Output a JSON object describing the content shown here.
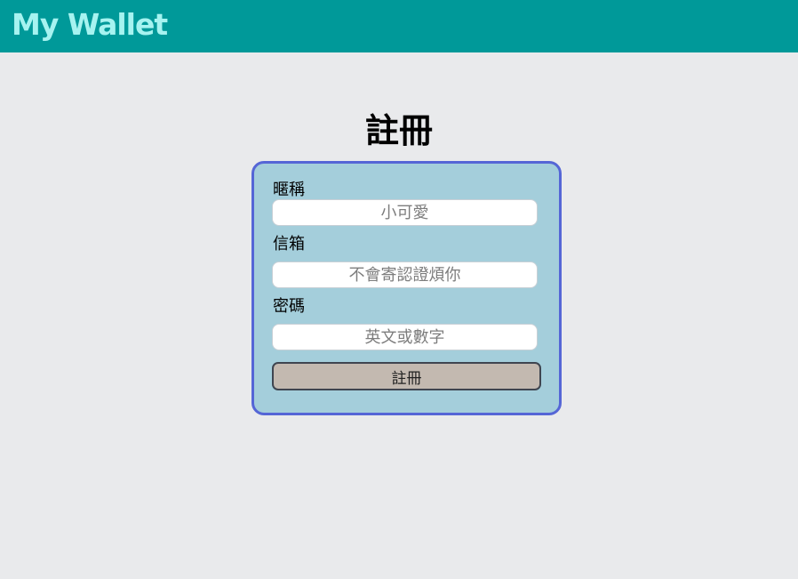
{
  "header": {
    "brand": "My Wallet"
  },
  "page": {
    "title": "註冊"
  },
  "form": {
    "nickname": {
      "label": "暱稱",
      "value": "",
      "placeholder": "小可愛"
    },
    "email": {
      "label": "信箱",
      "value": "",
      "placeholder": "不會寄認證煩你"
    },
    "password": {
      "label": "密碼",
      "value": "",
      "placeholder": "英文或數字"
    },
    "submit_label": "註冊"
  },
  "colors": {
    "header_bg": "#009999",
    "brand_text": "#a6f3f0",
    "page_bg": "#e9eaec",
    "card_bg": "#a4cedb",
    "card_border": "#5566d6",
    "button_bg": "#c3b9b0"
  }
}
